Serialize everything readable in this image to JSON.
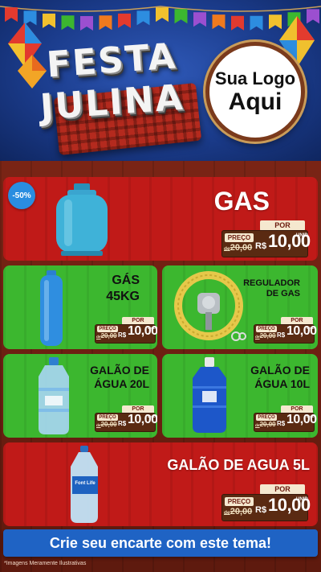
{
  "header": {
    "title_line1": "FESTA",
    "title_line2": "JULINA",
    "logo_line1": "Sua Logo",
    "logo_line2": "Aqui"
  },
  "colors": {
    "header_blue": "#1b3c8c",
    "card_red": "#c01a18",
    "card_green": "#3cb72f",
    "cta_blue": "#1f63c4",
    "badge_blue": "#2a8de0",
    "wood": "#6b1a10"
  },
  "products": [
    {
      "name": "GAS",
      "badge": "-50%",
      "image": "gas-cylinder-icon",
      "price": {
        "por": "POR",
        "preco": "PREÇO",
        "old_prefix": "de",
        "old": "20,00",
        "currency": "R$",
        "value": "10,00",
        "unit": "UNID"
      }
    },
    {
      "name_line1": "GÁS",
      "name_line2": "45KG",
      "image": "tall-gas-cylinder-icon",
      "price": {
        "por": "POR",
        "preco": "PREÇO",
        "old_prefix": "de",
        "old": "20,00",
        "currency": "R$",
        "value": "10,00",
        "unit": "UNID"
      }
    },
    {
      "name_line1": "REGULADOR",
      "name_line2": "DE GAS",
      "image": "gas-regulator-icon",
      "price": {
        "por": "POR",
        "preco": "PREÇO",
        "old_prefix": "de",
        "old": "20,00",
        "currency": "R$",
        "value": "10,00",
        "unit": "UNID"
      }
    },
    {
      "name_line1": "GALÃO DE",
      "name_line2": "ÁGUA 20L",
      "image": "water-jug-20l-icon",
      "price": {
        "por": "POR",
        "preco": "PREÇO",
        "old_prefix": "de",
        "old": "20,00",
        "currency": "R$",
        "value": "10,00",
        "unit": "UNID"
      }
    },
    {
      "name_line1": "GALÃO DE",
      "name_line2": "ÁGUA 10L",
      "image": "water-jug-10l-icon",
      "price": {
        "por": "POR",
        "preco": "PREÇO",
        "old_prefix": "de",
        "old": "20,00",
        "currency": "R$",
        "value": "10,00",
        "unit": "UNID"
      }
    },
    {
      "name": "GALÃO DE AGUA 5L",
      "image": "water-bottle-5l-icon",
      "bottle_brand": "Font Life",
      "price": {
        "por": "POR",
        "preco": "PREÇO",
        "old_prefix": "de",
        "old": "20,00",
        "currency": "R$",
        "value": "10,00",
        "unit": "UNID"
      }
    }
  ],
  "cta": "Crie seu encarte com este tema!",
  "disclaimer": "*Imagens Meramente Ilustrativas"
}
